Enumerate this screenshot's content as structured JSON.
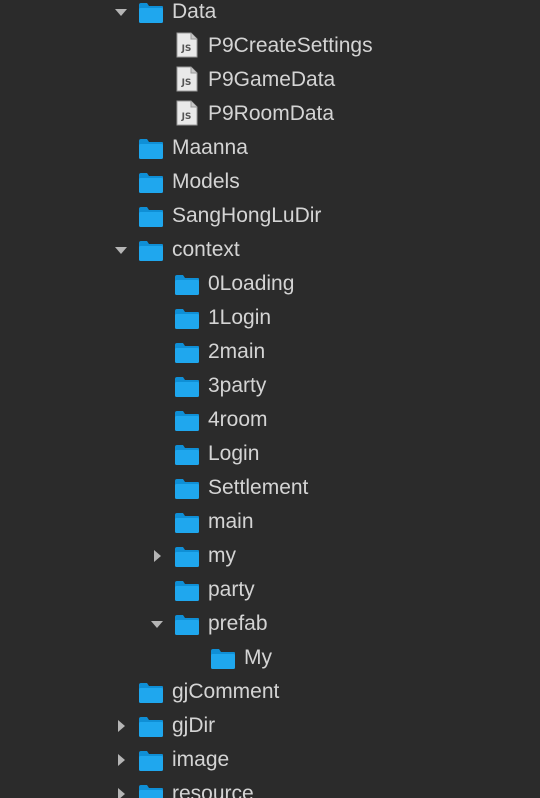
{
  "colors": {
    "background": "#2b2b2b",
    "text": "#d4d4d4",
    "folder": "#1fa7ee",
    "folder_tab": "#0f8fd6",
    "arrow": "#b5b5b5",
    "js_file_body": "#e9e9e9",
    "js_file_text": "#555555"
  },
  "js_badge": "JS",
  "items": [
    {
      "label": "Data",
      "type": "folder",
      "depth": 0,
      "state": "expanded"
    },
    {
      "label": "P9CreateSettings",
      "type": "js",
      "depth": 1,
      "state": "leaf"
    },
    {
      "label": "P9GameData",
      "type": "js",
      "depth": 1,
      "state": "leaf"
    },
    {
      "label": "P9RoomData",
      "type": "js",
      "depth": 1,
      "state": "leaf"
    },
    {
      "label": "Maanna",
      "type": "folder",
      "depth": 0,
      "state": "leaf"
    },
    {
      "label": "Models",
      "type": "folder",
      "depth": 0,
      "state": "leaf"
    },
    {
      "label": "SangHongLuDir",
      "type": "folder",
      "depth": 0,
      "state": "leaf"
    },
    {
      "label": "context",
      "type": "folder",
      "depth": 0,
      "state": "expanded"
    },
    {
      "label": "0Loading",
      "type": "folder",
      "depth": 1,
      "state": "leaf"
    },
    {
      "label": "1Login",
      "type": "folder",
      "depth": 1,
      "state": "leaf"
    },
    {
      "label": "2main",
      "type": "folder",
      "depth": 1,
      "state": "leaf"
    },
    {
      "label": "3party",
      "type": "folder",
      "depth": 1,
      "state": "leaf"
    },
    {
      "label": "4room",
      "type": "folder",
      "depth": 1,
      "state": "leaf"
    },
    {
      "label": "Login",
      "type": "folder",
      "depth": 1,
      "state": "leaf"
    },
    {
      "label": "Settlement",
      "type": "folder",
      "depth": 1,
      "state": "leaf"
    },
    {
      "label": "main",
      "type": "folder",
      "depth": 1,
      "state": "leaf"
    },
    {
      "label": "my",
      "type": "folder",
      "depth": 1,
      "state": "collapsed"
    },
    {
      "label": "party",
      "type": "folder",
      "depth": 1,
      "state": "leaf"
    },
    {
      "label": "prefab",
      "type": "folder",
      "depth": 1,
      "state": "expanded"
    },
    {
      "label": "My",
      "type": "folder",
      "depth": 2,
      "state": "leaf"
    },
    {
      "label": "gjComment",
      "type": "folder",
      "depth": 0,
      "state": "leaf"
    },
    {
      "label": "gjDir",
      "type": "folder",
      "depth": 0,
      "state": "collapsed"
    },
    {
      "label": "image",
      "type": "folder",
      "depth": 0,
      "state": "collapsed"
    },
    {
      "label": "resource",
      "type": "folder",
      "depth": 0,
      "state": "collapsed"
    }
  ]
}
